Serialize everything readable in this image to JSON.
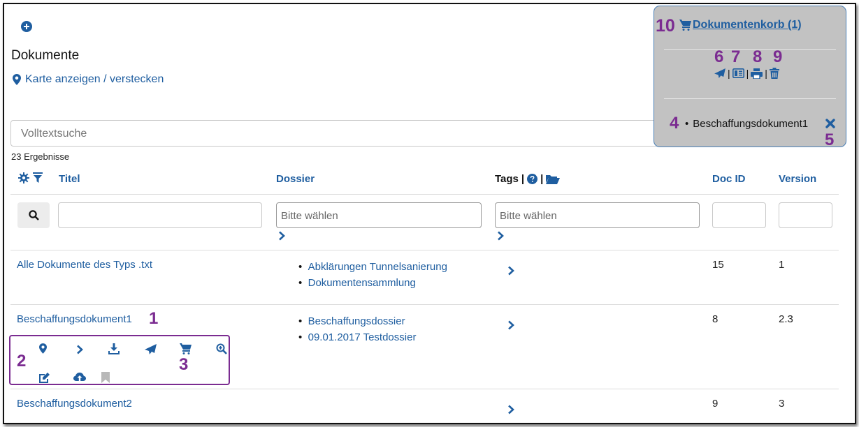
{
  "page": {
    "title": "Dokumente",
    "map_toggle": "Karte anzeigen / verstecken",
    "search_placeholder": "Volltextsuche",
    "result_count": "23 Ergebnisse"
  },
  "table": {
    "headers": {
      "title": "Titel",
      "dossier": "Dossier",
      "tags": "Tags",
      "tags_sep": "|",
      "doc_id": "Doc ID",
      "version": "Version"
    },
    "filters": {
      "dossier_placeholder": "Bitte wählen",
      "tags_placeholder": "Bitte wählen"
    },
    "rows": [
      {
        "title": "Alle Dokumente des Typs .txt",
        "dossiers": [
          "Abklärungen Tunnelsanierung",
          "Dokumentensammlung"
        ],
        "doc_id": "15",
        "version": "1"
      },
      {
        "title": "Beschaffungsdokument1",
        "dossiers": [
          "Beschaffungsdossier",
          "09.01.2017 Testdossier"
        ],
        "doc_id": "8",
        "version": "2.3"
      },
      {
        "title": "Beschaffungsdokument2",
        "dossiers": [],
        "doc_id": "9",
        "version": "3"
      }
    ]
  },
  "basket": {
    "title": "Dokumentenkorb (1)",
    "action_sep": "|",
    "items": [
      "Beschaffungsdokument1"
    ],
    "bullet": "•"
  },
  "annotations": {
    "n1": "1",
    "n2": "2",
    "n3": "3",
    "n4": "4",
    "n5": "5",
    "n6": "6",
    "n7": "7",
    "n8": "8",
    "n9": "9",
    "n10": "10"
  },
  "colors": {
    "link": "#1f5ea0",
    "annotation": "#7b2c91",
    "basket_bg": "#c2c2c2",
    "basket_border": "#4a7fb5"
  }
}
